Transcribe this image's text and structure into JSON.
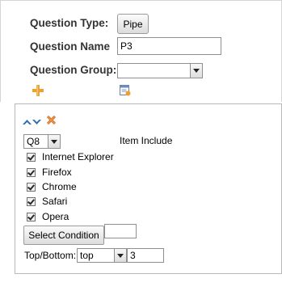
{
  "form": {
    "question_type_label": "Question Type:",
    "question_type_button": "Pipe",
    "question_name_label": "Question Name",
    "question_name_value": "P3",
    "question_group_label": "Question Group:",
    "question_group_value": ""
  },
  "pipe": {
    "source_select": "Q8",
    "item_include_label": "Item Include",
    "items": [
      {
        "label": "Internet Explorer",
        "checked": true
      },
      {
        "label": "Firefox",
        "checked": true
      },
      {
        "label": "Chrome",
        "checked": true
      },
      {
        "label": "Safari",
        "checked": true
      },
      {
        "label": "Opera",
        "checked": true
      }
    ],
    "select_condition_button": "Select Condition",
    "condition_value": "",
    "top_bottom_label": "Top/Bottom:",
    "top_bottom_select": "top",
    "top_bottom_count": "3"
  },
  "icons": {
    "add": "plus-icon",
    "group": "group-settings-icon",
    "move_up": "arrow-up-icon",
    "move_down": "arrow-down-icon",
    "delete": "delete-x-icon"
  },
  "colors": {
    "label_text": "#333333",
    "add_icon": "#f0a030",
    "arrow_icon": "#2d6db5",
    "delete_icon": "#d96a1a"
  }
}
